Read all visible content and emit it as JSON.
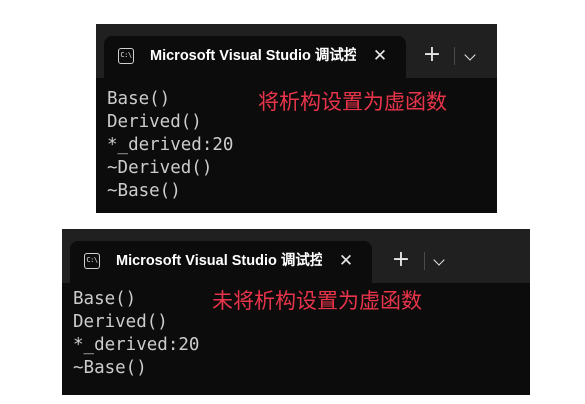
{
  "windows": [
    {
      "tab_icon_text": "C:\\",
      "tab_title": "Microsoft Visual Studio 调试控制台",
      "tab_close_glyph": "✕",
      "new_tab_glyph": "+",
      "annotation": "将析构设置为虚函数",
      "output_lines": [
        "Base()",
        "Derived()",
        "*_derived:20",
        "~Derived()",
        "~Base()"
      ]
    },
    {
      "tab_icon_text": "C:\\",
      "tab_title": "Microsoft Visual Studio 调试控制台",
      "tab_close_glyph": "✕",
      "new_tab_glyph": "+",
      "annotation": "未将析构设置为虚函数",
      "output_lines": [
        "Base()",
        "Derived()",
        "*_derived:20",
        "~Base()"
      ]
    }
  ],
  "colors": {
    "terminal_bg": "#0c0c0c",
    "tabbar_bg": "#202020",
    "output_text": "#cccccc",
    "annotation_text": "#e8344a"
  },
  "icons": [
    "terminal-icon",
    "close-icon",
    "plus-icon",
    "chevron-down-icon"
  ]
}
